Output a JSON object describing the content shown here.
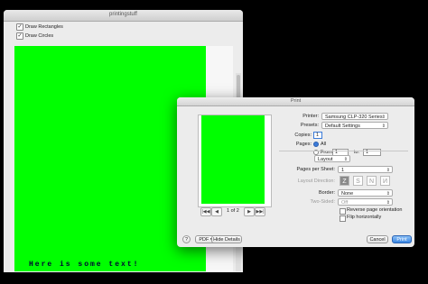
{
  "main_window": {
    "title": "printingstuff",
    "draw_rectangles": "Draw Rectangles",
    "draw_circles": "Draw Circles",
    "canvas_text": "Here is some text!"
  },
  "print_dialog": {
    "title": "Print",
    "printer_label": "Printer:",
    "printer_value": "Samsung CLP-320 Series",
    "presets_label": "Presets:",
    "presets_value": "Default Settings",
    "copies_label": "Copies:",
    "copies_value": "1",
    "pages_label": "Pages:",
    "pages_all": "All",
    "pages_from": "From:",
    "from_value": "1",
    "to_label": "to:",
    "to_value": "1",
    "section": "Layout",
    "pages_per_sheet_label": "Pages per Sheet:",
    "pages_per_sheet_value": "1",
    "layout_direction_label": "Layout Direction:",
    "border_label": "Border:",
    "border_value": "None",
    "two_sided_label": "Two-Sided:",
    "two_sided_value": "Off",
    "reverse_orientation": "Reverse page orientation",
    "flip_horizontally": "Flip horizontally",
    "page_indicator": "1 of 2",
    "help": "?",
    "pdf": "PDF",
    "hide_details": "Hide Details",
    "cancel": "Cancel",
    "print": "Print",
    "nav": {
      "first": "|◀◀",
      "prev": "◀",
      "next": "▶",
      "last": "▶▶|"
    }
  }
}
